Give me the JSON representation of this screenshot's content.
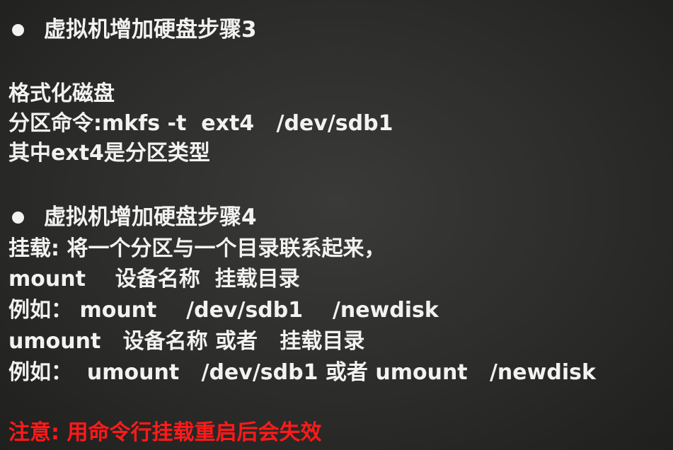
{
  "step3": {
    "heading": "虚拟机增加硬盘步骤3",
    "lines": [
      "格式化磁盘",
      "分区命令:mkfs -t  ext4   /dev/sdb1",
      "其中ext4是分区类型"
    ]
  },
  "step4": {
    "heading": "虚拟机增加硬盘步骤4",
    "lines": [
      "挂载: 将一个分区与一个目录联系起来，",
      "mount    设备名称  挂载目录",
      "例如： mount    /dev/sdb1    /newdisk",
      "umount   设备名称 或者   挂载目录",
      "例如：  umount   /dev/sdb1 或者 umount   /newdisk"
    ]
  },
  "note": "注意: 用命令行挂载重启后会失效",
  "colors": {
    "text": "#f2f2f2",
    "warning": "#ff1a1a",
    "background": "#2c2c2a"
  }
}
